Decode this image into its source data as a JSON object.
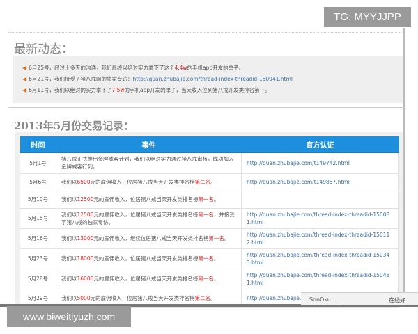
{
  "badge": "TG: MYYJJPP",
  "news": {
    "title": "最新动态：",
    "items": [
      {
        "date": "6月25号，",
        "pre": "经过十多天的沟通，我们最终以绝对实力拿下了这个",
        "amount": "4.4w",
        "post": "的手机app开发的单子。",
        "link": ""
      },
      {
        "date": "6月21号，",
        "pre": "我们接受了猪八戒网的独家专访：",
        "amount": "",
        "post": "",
        "link": "http://quan.zhubajie.com/thread-index-threadid-150941.html"
      },
      {
        "date": "6月11号，",
        "pre": "我们以绝对的实力拿下了",
        "amount": "7.5w",
        "post": "的手机app开发的单子，当天收入位列猪八戒开发类排名第一。",
        "link": ""
      }
    ]
  },
  "records": {
    "title": "2013年5月份交易记录：",
    "headers": [
      "时间",
      "事件",
      "官方认证"
    ],
    "rows": [
      {
        "date": "5月1号",
        "pre": "猪八戒正式推出金牌威客计划，我们以绝对实力通过猪八戒审核，成功加入金牌威客行列。",
        "amount": "",
        "mid": "",
        "rank": "",
        "post": "",
        "link": "http://quan.zhubajie.com/t149742.html"
      },
      {
        "date": "5月6号",
        "pre": "我们以",
        "amount": "6500",
        "mid": "元的雇佣收入，位居猪八戒当天开发类排名榜",
        "rank": "第二名",
        "post": "。",
        "link": "http://quan.zhubajie.com/t149857.html"
      },
      {
        "date": "5月10号",
        "pre": "我们以",
        "amount": "12500",
        "mid": "元的雇佣收入，位居猪八戒当天开发类排名榜",
        "rank": "第一名",
        "post": "。",
        "link": ""
      },
      {
        "date": "5月15号",
        "pre": "我们以",
        "amount": "12500",
        "mid": "元的雇佣收入，位居猪八戒当天开发类排名榜",
        "rank": "第一名",
        "post": "，并接受了猪八戒的独家专访。",
        "link": "http://quan.zhubajie.com/thread-index-threadid-150081.html"
      },
      {
        "date": "5月16号",
        "pre": "我们以",
        "amount": "13000",
        "mid": "元的雇佣收入，继续位居猪八戒当天开发类排名榜",
        "rank": "第一名",
        "post": "。",
        "link": "http://quan.zhubajie.com/thread-index-threadid-150112.html"
      },
      {
        "date": "5月23号",
        "pre": "我们以",
        "amount": "18000",
        "mid": "元的雇佣收入，位居猪八戒当天开发类排名榜",
        "rank": "第一名",
        "post": "。",
        "link": "http://quan.zhubajie.com/thread-index-threadid-150343.html"
      },
      {
        "date": "5月28号",
        "pre": "我们以",
        "amount": "16000",
        "mid": "元的雇佣收入，位居猪八戒当天开发类排名榜",
        "rank": "第一名",
        "post": "。",
        "link": "http://quan.zhubajie.com/thread-index-threadid-150481.html"
      },
      {
        "date": "5月29号",
        "pre": "我们以",
        "amount": "5000",
        "mid": "元的雇佣收入，位居猪八戒当天开发类排名榜",
        "rank": "第二名",
        "post": "。",
        "link": "http://quan.zhubajie.c html"
      }
    ]
  },
  "watermark": "www.biweitiyuzh.com",
  "chat": {
    "name": "SonOku...",
    "status": "在线好"
  },
  "colors": {
    "header": "#1e8fdc",
    "highlight": "#dd2222",
    "link": "#3a6ea0"
  }
}
